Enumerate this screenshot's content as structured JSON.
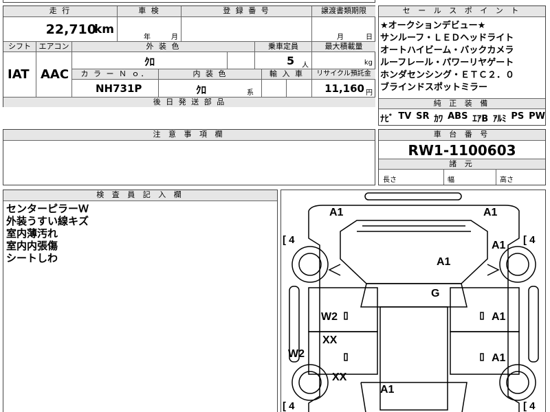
{
  "top_row": {
    "mileage_label": "走 行",
    "mileage_value": "22,710",
    "mileage_unit": "km",
    "inspection_label": "車 検",
    "inspection_year": "年",
    "inspection_month": "月",
    "registration_label": "登 録 番 号",
    "transfer_label": "譲渡書類期限",
    "transfer_month": "月",
    "transfer_day": "日"
  },
  "row2": {
    "shift_label": "シフト",
    "shift_value": "IAT",
    "aircon_label": "エアコン",
    "aircon_value": "AAC",
    "exterior_label": "外 装 色",
    "exterior_value": "ｸﾛ",
    "capacity_label": "乗車定員",
    "capacity_value": "5",
    "capacity_unit": "人",
    "max_load_label": "最大積載量",
    "max_load_unit": "kg",
    "color_no_label": "カ ラ ー Ｎ ｏ．",
    "color_no_value": "NH731P",
    "interior_label": "内 装 色",
    "interior_value": "ｸﾛ",
    "interior_suffix": "系",
    "import_label": "輸 入 車",
    "recycle_label": "リサイクル預託金",
    "recycle_value": "11,160",
    "recycle_unit": "円",
    "shipping_label": "後 日 発 送 部 品"
  },
  "selling_points": {
    "header": "セ ー ル ス ポ イ ン ト",
    "lines": [
      "★オークションデビュー★",
      "サンルーフ・ＬＥＤヘッドライト",
      "オートハイビーム・バックカメラ",
      "ルーフレール・パワーリヤゲート",
      "ホンダセンシング・ＥＴＣ２．０",
      "ブラインドスポットミラー"
    ],
    "equipment_header": "純 正 装 備",
    "equipment": [
      "ﾅﾋﾞ",
      "TV",
      "SR",
      "ｶﾜ",
      "ABS",
      "ｴｱB",
      "ｱﾙﾐ",
      "PS",
      "PW"
    ]
  },
  "notes": {
    "header": "注 意 事 項 欄"
  },
  "chassis": {
    "header": "車 台 番 号",
    "value": "RW1-1100603",
    "dims_header": "諸 元",
    "length": "長さ",
    "width": "幅",
    "height": "高さ"
  },
  "inspector": {
    "header": "検 査 員 記 入 欄",
    "lines": [
      "センターピラーＷ",
      "外装うすい線キズ",
      "室内薄汚れ",
      "室内内張傷",
      "シートしわ"
    ]
  },
  "diagram": {
    "marks": {
      "front_left": "A1",
      "front_right": "A1",
      "hood": "A1",
      "front_right_fender": "A1",
      "windshield": "G",
      "left_front_door": "W2",
      "right_front_door": "A1",
      "left_rear_door": "XX",
      "right_rear_door": "A1",
      "left_sill": "W2",
      "left_rear_fender": "XX",
      "roof_rear": "A1"
    },
    "tire_tl": "4",
    "tire_tr": "4",
    "tire_bl": "4",
    "tire_br": "4",
    "bracket_open": "[",
    "bracket_close": "]"
  }
}
